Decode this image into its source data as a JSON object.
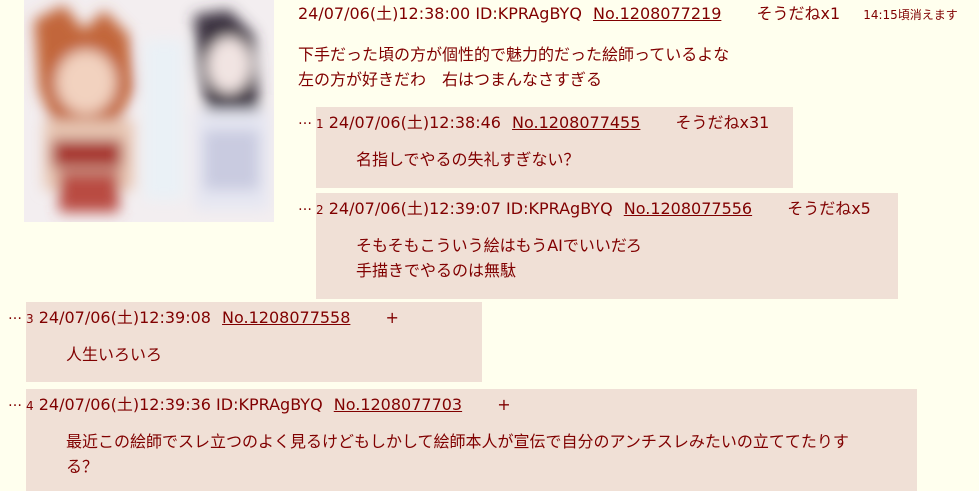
{
  "op": {
    "date": "24/07/06(土)12:38:00",
    "id": "ID:KPRAgBYQ",
    "no": "No.1208077219",
    "sodane": "そうだねx1",
    "expire": "14:15頃消えます",
    "lines": [
      "下手だった頃の方が個性的で魅力的だった絵師っているよな",
      "左の方が好きだわ　右はつまんなさすぎる"
    ]
  },
  "replies": [
    {
      "dots": "…",
      "num": "1",
      "date": "24/07/06(土)12:38:46",
      "id": "",
      "no": "No.1208077455",
      "sodane": "そうだねx31",
      "lines": [
        "名指しでやるの失礼すぎない？"
      ]
    },
    {
      "dots": "…",
      "num": "2",
      "date": "24/07/06(土)12:39:07",
      "id": "ID:KPRAgBYQ",
      "no": "No.1208077556",
      "sodane": "そうだねx5",
      "lines": [
        "そもそもこういう絵はもうAIでいいだろ",
        "手描きでやるのは無駄"
      ]
    },
    {
      "dots": "…",
      "num": "3",
      "date": "24/07/06(土)12:39:08",
      "id": "",
      "no": "No.1208077558",
      "sodane": "+",
      "lines": [
        "人生いろいろ"
      ]
    },
    {
      "dots": "…",
      "num": "4",
      "date": "24/07/06(土)12:39:36",
      "id": "ID:KPRAgBYQ",
      "no": "No.1208077703",
      "sodane": "+",
      "lines": [
        "最近この絵師でスレ立つのよく見るけどもしかして絵師本人が宣伝で自分のアンチスレみたいの立ててたりす",
        "る？"
      ]
    }
  ]
}
